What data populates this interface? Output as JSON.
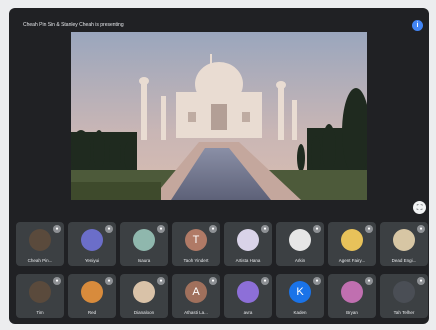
{
  "meeting": {
    "presenting_text": "Cheah Pin Sin & Stanley Cheah is presenting",
    "info_icon": "info-icon",
    "fullscreen_icon": "fullscreen-icon"
  },
  "participants_row1": [
    {
      "name": "Cheah Pin...",
      "avatar": "photo",
      "color": "#5a4a3c"
    },
    {
      "name": "Yeniyui",
      "avatar": "anime",
      "color": "#6b6ec9"
    },
    {
      "name": "Isaura",
      "avatar": "circle",
      "color": "#8fb7ad"
    },
    {
      "name": "Taoh Yindert",
      "avatar": "T",
      "color": "#b07a66"
    },
    {
      "name": "Artista Hana",
      "avatar": "anime",
      "color": "#d9d3e8"
    },
    {
      "name": "Arkin",
      "avatar": "anime",
      "color": "#e6e6e6"
    },
    {
      "name": "Agent Fairy...",
      "avatar": "anime",
      "color": "#e8c25a"
    },
    {
      "name": "Dead Engi...",
      "avatar": "retro",
      "color": "#d7c6a4"
    }
  ],
  "participants_row2": [
    {
      "name": "Tim",
      "avatar": "photo",
      "color": "#5a4a3c"
    },
    {
      "name": "Red",
      "avatar": "anime",
      "color": "#d88b3c"
    },
    {
      "name": "Dianaloon",
      "avatar": "anime",
      "color": "#d9c2a8"
    },
    {
      "name": "Athasti La...",
      "avatar": "A",
      "color": "#a0705c"
    },
    {
      "name": "avra",
      "avatar": "anime",
      "color": "#8d6fd8"
    },
    {
      "name": "Kaden",
      "avatar": "K",
      "color": "#1a73e8"
    },
    {
      "name": "Bryan",
      "avatar": "anime",
      "color": "#c06fb0"
    },
    {
      "name": "Tah Telher",
      "avatar": "dark",
      "color": "#4a4e55"
    }
  ]
}
